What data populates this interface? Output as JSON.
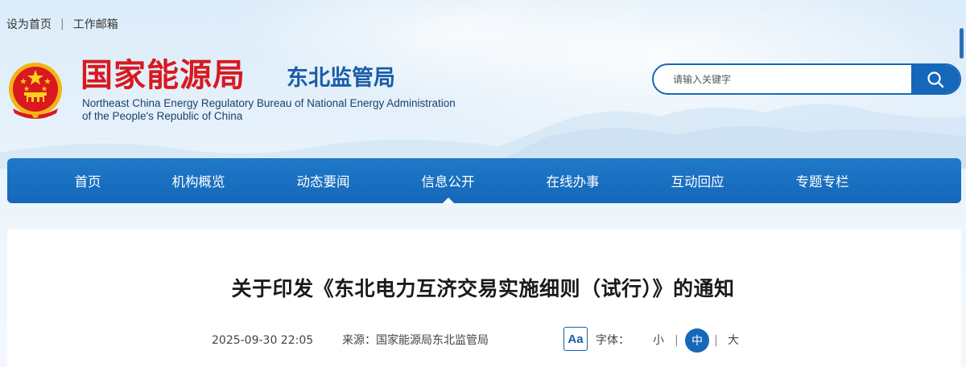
{
  "top_links": [
    "设为首页",
    "工作邮箱"
  ],
  "brand": {
    "name": "国家能源局",
    "sub": "东北监管局",
    "en_line1": "Northeast China Energy Regulatory Bureau of National Energy Administration",
    "en_line2": "of the People's Republic of China"
  },
  "search": {
    "placeholder": "请输入关键字"
  },
  "nav": {
    "items": [
      "首页",
      "机构概览",
      "动态要闻",
      "信息公开",
      "在线办事",
      "互动回应",
      "专题专栏"
    ],
    "active": "信息公开"
  },
  "article": {
    "title": "关于印发《东北电力互济交易实施细则（试行）》的通知",
    "datetime": "2025-09-30 22:05",
    "source_label": "来源：",
    "source": "国家能源局东北监管局",
    "font_icon": "Aa",
    "font_label": "字体：",
    "font_small": "小",
    "font_medium": "中",
    "font_large": "大",
    "font_active": "中"
  },
  "colors": {
    "brand_red": "#d9181f",
    "brand_blue": "#1567b9",
    "nav_blue": "#1567b9"
  }
}
